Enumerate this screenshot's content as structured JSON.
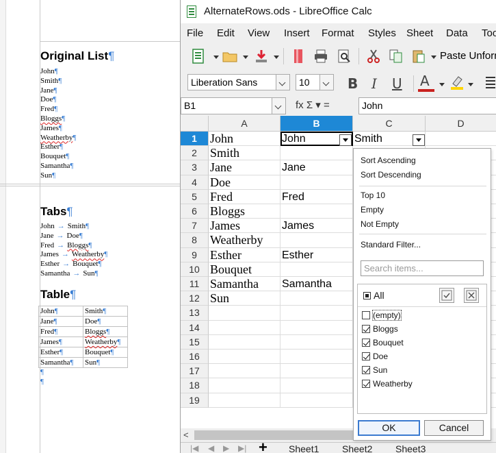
{
  "writer": {
    "heading1": "Original List",
    "list": [
      "John",
      "Smith",
      "Jane",
      "Doe",
      "Fred",
      "Bloggs",
      "James",
      "Weatherby",
      "Esther",
      "Bouquet",
      "Samantha",
      "Sun"
    ],
    "heading2": "Tabs",
    "tabs_lines": [
      {
        "a": "John",
        "b": "Smith"
      },
      {
        "a": "Jane",
        "b": "Doe"
      },
      {
        "a": "Fred",
        "b": "Bloggs"
      },
      {
        "a": "James",
        "b": "Weatherby"
      },
      {
        "a": "Esther",
        "b": "Bouquet"
      },
      {
        "a": "Samantha",
        "b": "Sun"
      }
    ],
    "heading3": "Table",
    "table": [
      [
        "John",
        "Smith"
      ],
      [
        "Jane",
        "Doe"
      ],
      [
        "Fred",
        "Bloggs"
      ],
      [
        "James",
        "Weatherby"
      ],
      [
        "Esther",
        "Bouquet"
      ],
      [
        "Samantha",
        "Sun"
      ]
    ],
    "pilcrow": "¶"
  },
  "calc": {
    "title": "AlternateRows.ods - LibreOffice Calc",
    "menu": [
      "File",
      "Edit",
      "View",
      "Insert",
      "Format",
      "Styles",
      "Sheet",
      "Data",
      "Too"
    ],
    "paste_label": "Paste Unforn",
    "font_name": "Liberation Sans",
    "font_size": "10",
    "name_box": "B1",
    "formula_value": "John",
    "fx_label": "fx Σ ▾ =",
    "columns": [
      "A",
      "B",
      "C",
      "D"
    ],
    "selected_column": "B",
    "selected_row": "1",
    "rows": [
      "1",
      "2",
      "3",
      "4",
      "5",
      "6",
      "7",
      "8",
      "9",
      "10",
      "11",
      "12",
      "13",
      "14",
      "15",
      "16",
      "17",
      "18",
      "19"
    ],
    "col_a": [
      "John",
      "Smith",
      "Jane",
      "Doe",
      "Fred",
      "Bloggs",
      "James",
      "Weatherby",
      "Esther",
      "Bouquet",
      "Samantha",
      "Sun"
    ],
    "col_b": [
      "John",
      "",
      "Jane",
      "",
      "Fred",
      "",
      "James",
      "",
      "Esther",
      "",
      "Samantha",
      ""
    ],
    "c1": "Smith",
    "sheet_tabs": [
      "Sheet1",
      "Sheet2",
      "Sheet3"
    ],
    "add_sheet": "+"
  },
  "autofilter": {
    "sort_asc": "Sort Ascending",
    "sort_desc": "Sort Descending",
    "top10": "Top 10",
    "empty": "Empty",
    "not_empty": "Not Empty",
    "standard_filter": "Standard Filter...",
    "search_placeholder": "Search items...",
    "all_label": "All",
    "items": [
      {
        "label": "(empty)",
        "checked": false
      },
      {
        "label": "Bloggs",
        "checked": true
      },
      {
        "label": "Bouquet",
        "checked": true
      },
      {
        "label": "Doe",
        "checked": true
      },
      {
        "label": "Sun",
        "checked": true
      },
      {
        "label": "Weatherby",
        "checked": true
      }
    ],
    "ok": "OK",
    "cancel": "Cancel"
  }
}
